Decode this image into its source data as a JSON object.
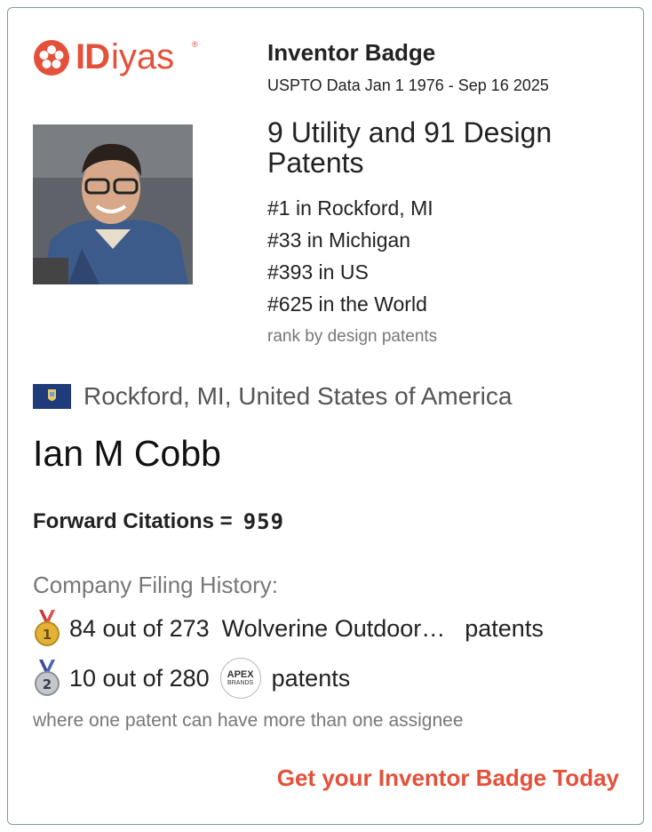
{
  "brand": {
    "logo_bold": "ID",
    "logo_light": "iyas",
    "registered": "®",
    "color": "#e4503a"
  },
  "header": {
    "title": "Inventor Badge",
    "subtitle": "USPTO Data Jan 1 1976 - Sep 16 2025"
  },
  "stats": {
    "patents": "9 Utility and 91 Design Patents",
    "ranks": [
      "#1 in Rockford, MI",
      "#33 in Michigan",
      "#393 in US",
      "#625 in the World"
    ],
    "rank_note": "rank by design patents"
  },
  "location": {
    "text": "Rockford, MI, United States of America",
    "flag_icon": "michigan-flag-icon"
  },
  "inventor": {
    "name": "Ian M Cobb"
  },
  "citations": {
    "label": "Forward Citations =",
    "value": "959"
  },
  "history": {
    "label": "Company Filing History:",
    "rows": [
      {
        "medal_icon": "gold-medal-icon",
        "medal_number": "1",
        "count": "84 out of 273",
        "company": "Wolverine Outdoor…",
        "suffix": "patents"
      },
      {
        "medal_icon": "silver-medal-icon",
        "medal_number": "2",
        "count": "10 out of 280",
        "company_logo_top": "APEX",
        "company_logo_bottom": "BRANDS",
        "suffix": "patents"
      }
    ],
    "footnote": "where one patent can have more than one assignee"
  },
  "cta": {
    "label": "Get your Inventor Badge Today"
  }
}
